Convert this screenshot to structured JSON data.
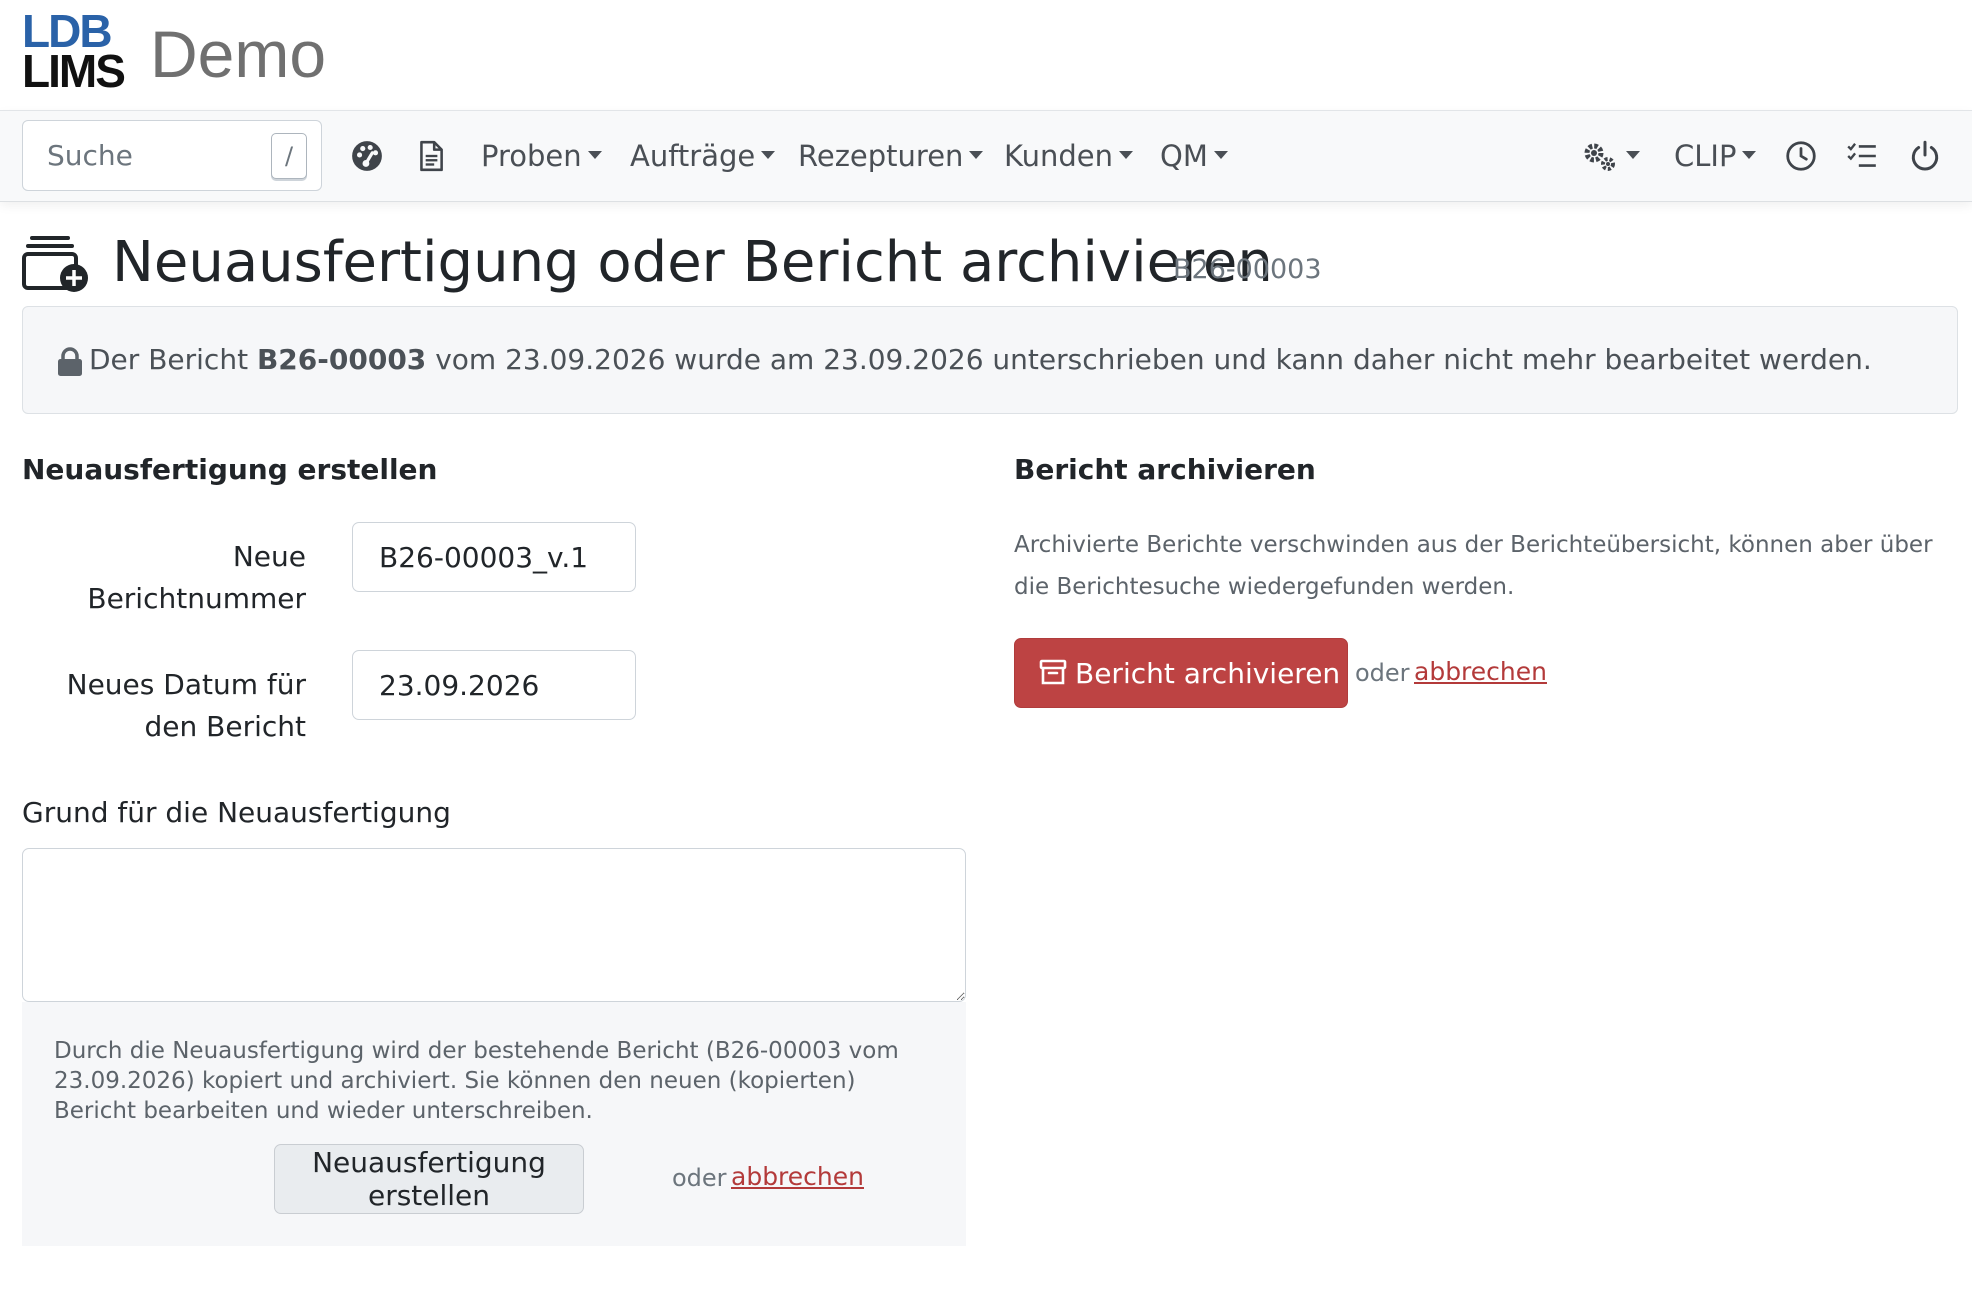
{
  "brand": {
    "logo_line1": "LDB",
    "logo_line2": "LIMS",
    "title": "Demo"
  },
  "navbar": {
    "search_placeholder": "Suche",
    "search_shortcut": "/",
    "items": [
      {
        "label": "Proben"
      },
      {
        "label": "Aufträge"
      },
      {
        "label": "Rezepturen"
      },
      {
        "label": "Kunden"
      },
      {
        "label": "QM"
      }
    ],
    "user_label": "CLIP"
  },
  "page": {
    "title": "Neuausfertigung oder Bericht archivieren",
    "report_id": "B26-00003"
  },
  "alert": {
    "prefix": "Der Bericht",
    "report_id": "B26-00003",
    "suffix": "vom 23.09.2026 wurde am 23.09.2026 unterschrieben und kann daher nicht mehr bearbeitet werden."
  },
  "reissue": {
    "heading": "Neuausfertigung erstellen",
    "new_number_label": "Neue Berichtnummer",
    "new_number_value": "B26-00003_v.1",
    "new_date_label": "Neues Datum für den Bericht",
    "new_date_value": "23.09.2026",
    "reason_label": "Grund für die Neuausfertigung",
    "reason_value": "",
    "info_text": "Durch die Neuausfertigung wird der bestehende Bericht (B26-00003 vom 23.09.2026) kopiert und archiviert. Sie können den neuen (kopierten) Bericht bearbeiten und wieder unterschreiben.",
    "submit_label": "Neuausfertigung erstellen",
    "or_text": "oder",
    "cancel_label": "abbrechen"
  },
  "archive": {
    "heading": "Bericht archivieren",
    "description": "Archivierte Berichte verschwinden aus der Berichteübersicht, können aber über die Berichtesuche wiedergefunden werden.",
    "submit_label": "Bericht archivieren",
    "or_text": "oder",
    "cancel_label": "abbrechen"
  },
  "colors": {
    "danger": "#bd4343",
    "link": "#b33a3a",
    "logo_blue": "#2a62a8"
  }
}
